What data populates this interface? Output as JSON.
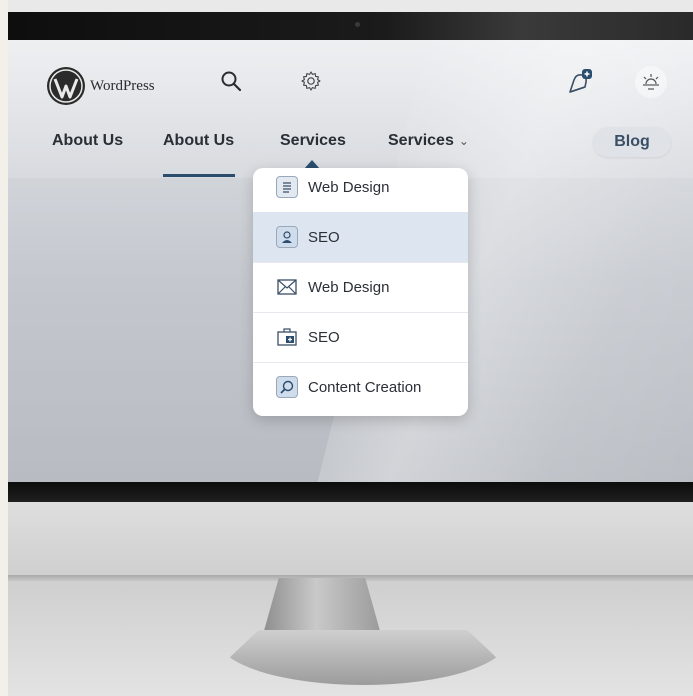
{
  "brand": {
    "name": "WordPress"
  },
  "header": {
    "icons": [
      "search-icon",
      "gear-icon",
      "notification-bell-icon",
      "sun-icon"
    ]
  },
  "nav": {
    "items": [
      {
        "label": "About Us"
      },
      {
        "label": "About Us",
        "active": true
      },
      {
        "label": "Services"
      },
      {
        "label": "Services",
        "has_dropdown": true
      }
    ],
    "blog_label": "Blog"
  },
  "dropdown": {
    "items": [
      {
        "label": "Web Design",
        "icon": "document-icon"
      },
      {
        "label": "SEO",
        "icon": "user-icon",
        "highlighted": true
      },
      {
        "label": "Web Design",
        "icon": "envelope-icon"
      },
      {
        "label": "SEO",
        "icon": "briefcase-icon"
      },
      {
        "label": "Content Creation",
        "icon": "magnifier-icon"
      }
    ]
  },
  "colors": {
    "accent": "#2a4d6e",
    "highlight": "#dde6f0",
    "blog_button_bg": "#dfe3e8"
  }
}
